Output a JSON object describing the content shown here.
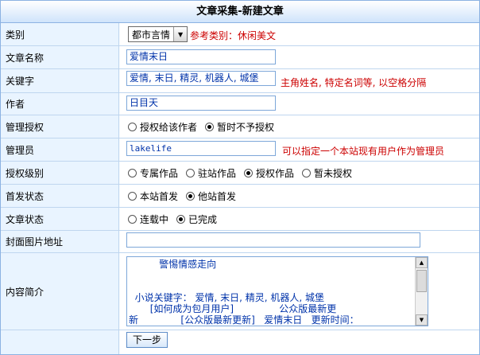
{
  "page": {
    "title": "文章采集-新建文章"
  },
  "category": {
    "label": "类别",
    "selected": "都市言情",
    "hint": "参考类别：休闲美文"
  },
  "article_name": {
    "label": "文章名称",
    "value": "爱情末日"
  },
  "keywords": {
    "label": "关键字",
    "value": "爱情, 末日, 精灵, 机器人, 城堡",
    "hint": "主角姓名, 特定名词等, 以空格分隔"
  },
  "author": {
    "label": "作者",
    "value": "日目天"
  },
  "mgmt_auth": {
    "label": "管理授权",
    "options": [
      "授权给该作者",
      "暂时不予授权"
    ],
    "selected_index": 1
  },
  "admin": {
    "label": "管理员",
    "value": "lakelife",
    "hint": "可以指定一个本站现有用户作为管理员"
  },
  "auth_level": {
    "label": "授权级别",
    "options": [
      "专属作品",
      "驻站作品",
      "授权作品",
      "暂未授权"
    ],
    "selected_index": 2
  },
  "first_status": {
    "label": "首发状态",
    "options": [
      "本站首发",
      "他站首发"
    ],
    "selected_index": 1
  },
  "article_status": {
    "label": "文章状态",
    "options": [
      "连载中",
      "已完成"
    ],
    "selected_index": 1
  },
  "cover_url": {
    "label": "封面图片地址",
    "value": ""
  },
  "summary": {
    "label": "内容简介",
    "lines": [
      "          警惕情感走向",
      "",
      "",
      "  小说关键字： 爱情, 末日, 精灵, 机器人, 城堡",
      "       [如何成为包月用户]               公众版最新更",
      "新              [公众版最新更新]   爱情末日   更新时间："
    ]
  },
  "submit": {
    "label": "下一步"
  }
}
